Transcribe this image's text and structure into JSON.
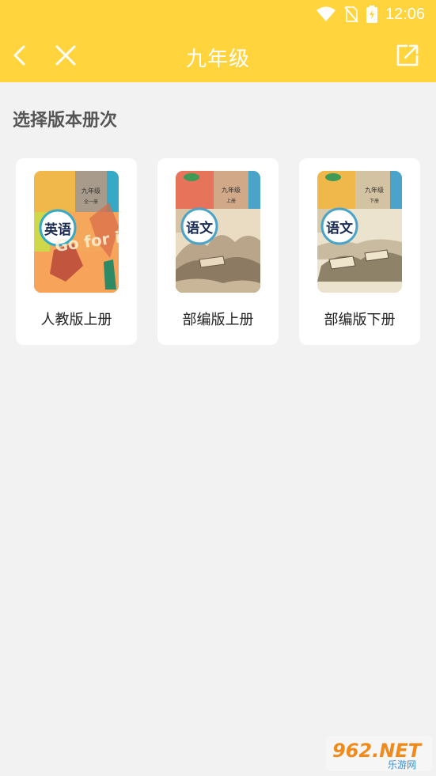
{
  "status_bar": {
    "time": "12:06",
    "icons": [
      "wifi-icon",
      "no-sim-icon",
      "battery-charging-icon"
    ]
  },
  "app_bar": {
    "title": "九年级",
    "back_icon": "chevron-left-icon",
    "close_icon": "close-icon",
    "share_icon": "share-icon"
  },
  "section_title": "选择版本册次",
  "books": [
    {
      "label": "人教版上册",
      "cover": {
        "subject": "英语",
        "grade": "九年级",
        "volume": "全一册",
        "art": "Go for it!"
      }
    },
    {
      "label": "部编版上册",
      "cover": {
        "subject": "语文",
        "grade": "九年级",
        "volume": "上册"
      }
    },
    {
      "label": "部编版下册",
      "cover": {
        "subject": "语文",
        "grade": "九年级",
        "volume": "下册"
      }
    }
  ],
  "watermark": {
    "brand": "962.NET",
    "site": "乐游网"
  },
  "colors": {
    "accent": "#ffd43d",
    "background": "#f2f2f2",
    "card": "#ffffff"
  }
}
